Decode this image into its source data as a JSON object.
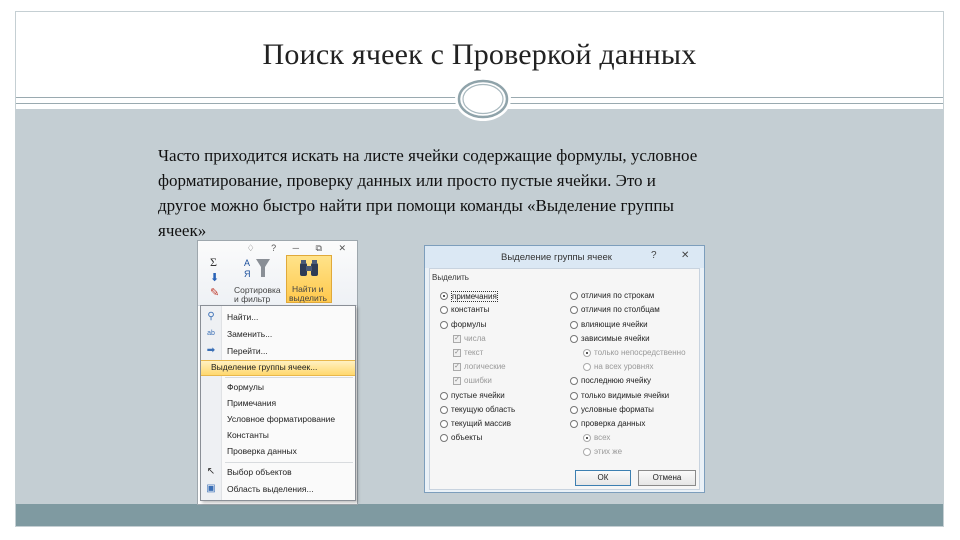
{
  "slide": {
    "title": "Поиск ячеек с Проверкой данных",
    "body_lines": [
      "Часто приходится искать на листе ячейки содержащие формулы, условное",
      "форматирование, проверку данных или просто пустые ячейки. Это и",
      "другое можно быстро найти при помощи команды «Выделение группы",
      "ячеек»"
    ],
    "colors": {
      "content_bg": "#c4ced3",
      "footer_bg": "#7f9aa1",
      "rule": "#9aaab0"
    }
  },
  "ribbon": {
    "window_buttons": "♢ ? ─ ⧉ ✕",
    "sigma": "Σ",
    "sort_label_1": "Сортировка",
    "sort_label_2": "и фильтр",
    "find_label_1": "Найти и",
    "find_label_2": "выделить",
    "menu": [
      {
        "label": "Найти...",
        "icon": "binoculars-icon",
        "glyph": "⚲"
      },
      {
        "label": "Заменить...",
        "icon": "replace-icon",
        "glyph": "ab"
      },
      {
        "label": "Перейти...",
        "icon": "arrow-right-icon",
        "glyph": "➡"
      },
      {
        "label": "Выделение группы ячеек...",
        "icon": "",
        "glyph": ""
      },
      {
        "label": "Формулы",
        "icon": "",
        "glyph": ""
      },
      {
        "label": "Примечания",
        "icon": "",
        "glyph": ""
      },
      {
        "label": "Условное форматирование",
        "icon": "",
        "glyph": ""
      },
      {
        "label": "Константы",
        "icon": "",
        "glyph": ""
      },
      {
        "label": "Проверка данных",
        "icon": "",
        "glyph": ""
      },
      {
        "label": "Выбор объектов",
        "icon": "cursor-icon",
        "glyph": "↖"
      },
      {
        "label": "Область выделения...",
        "icon": "selection-pane-icon",
        "glyph": "▣"
      }
    ]
  },
  "dialog": {
    "title": "Выделение группы ячеек",
    "help": "?",
    "close": "✕",
    "group_label": "Выделить",
    "left_options": [
      "примечания",
      "константы",
      "формулы",
      "числа",
      "текст",
      "логические",
      "ошибки",
      "пустые ячейки",
      "текущую область",
      "текущий массив",
      "объекты"
    ],
    "right_options": [
      "отличия по строкам",
      "отличия по столбцам",
      "влияющие ячейки",
      "зависимые ячейки",
      "только непосредственно",
      "на всех уровнях",
      "последнюю ячейку",
      "только видимые ячейки",
      "условные форматы",
      "проверка данных",
      "всех",
      "этих же"
    ],
    "selected": "примечания",
    "ok": "ОК",
    "cancel": "Отмена"
  }
}
